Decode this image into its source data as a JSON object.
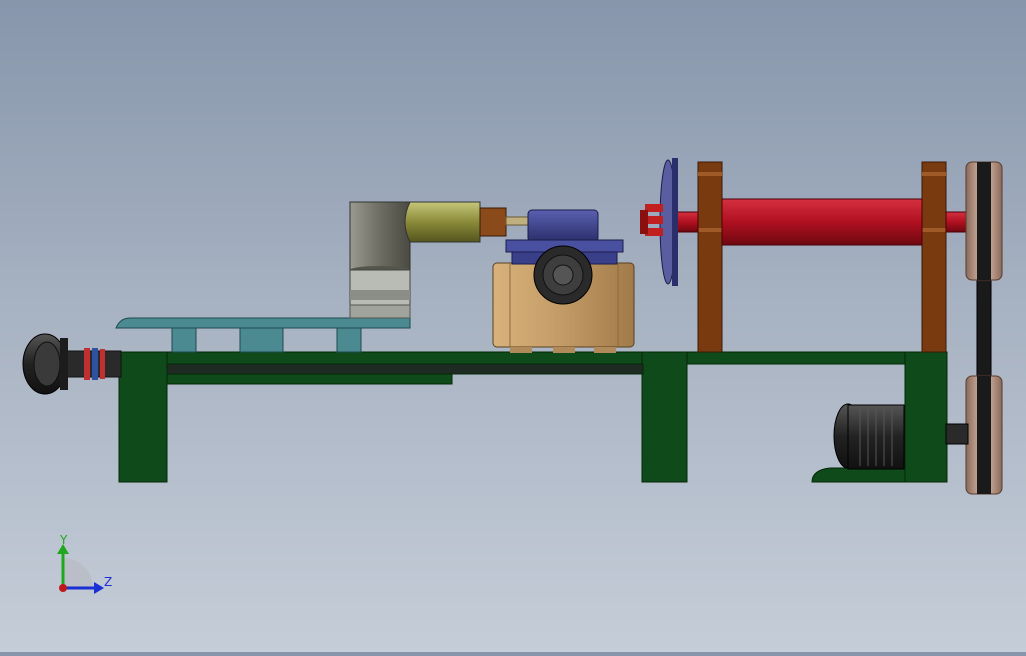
{
  "viewport": {
    "background_top": "#8796ac",
    "background_bottom": "#c5cdd8"
  },
  "triad": {
    "y_label": "Y",
    "z_label": "Z",
    "y_color": "#1fa81f",
    "z_color": "#1a2fd4",
    "x_color": "#c01818"
  },
  "colors": {
    "frame": "#0f4a1a",
    "frame_edge": "#052808",
    "plate": "#4a8a90",
    "gearbox": "#c29a66",
    "motor_blue": "#3a3f8a",
    "cylinder_olive": "#8a8a3a",
    "elbow_gray": "#7a7a70",
    "drum_red": "#b01020",
    "bracket_brown": "#7a3a10",
    "pulley_bronze": "#c7a090",
    "belt": "#1a1a1a",
    "dark_motor": "#2a2a2a"
  }
}
